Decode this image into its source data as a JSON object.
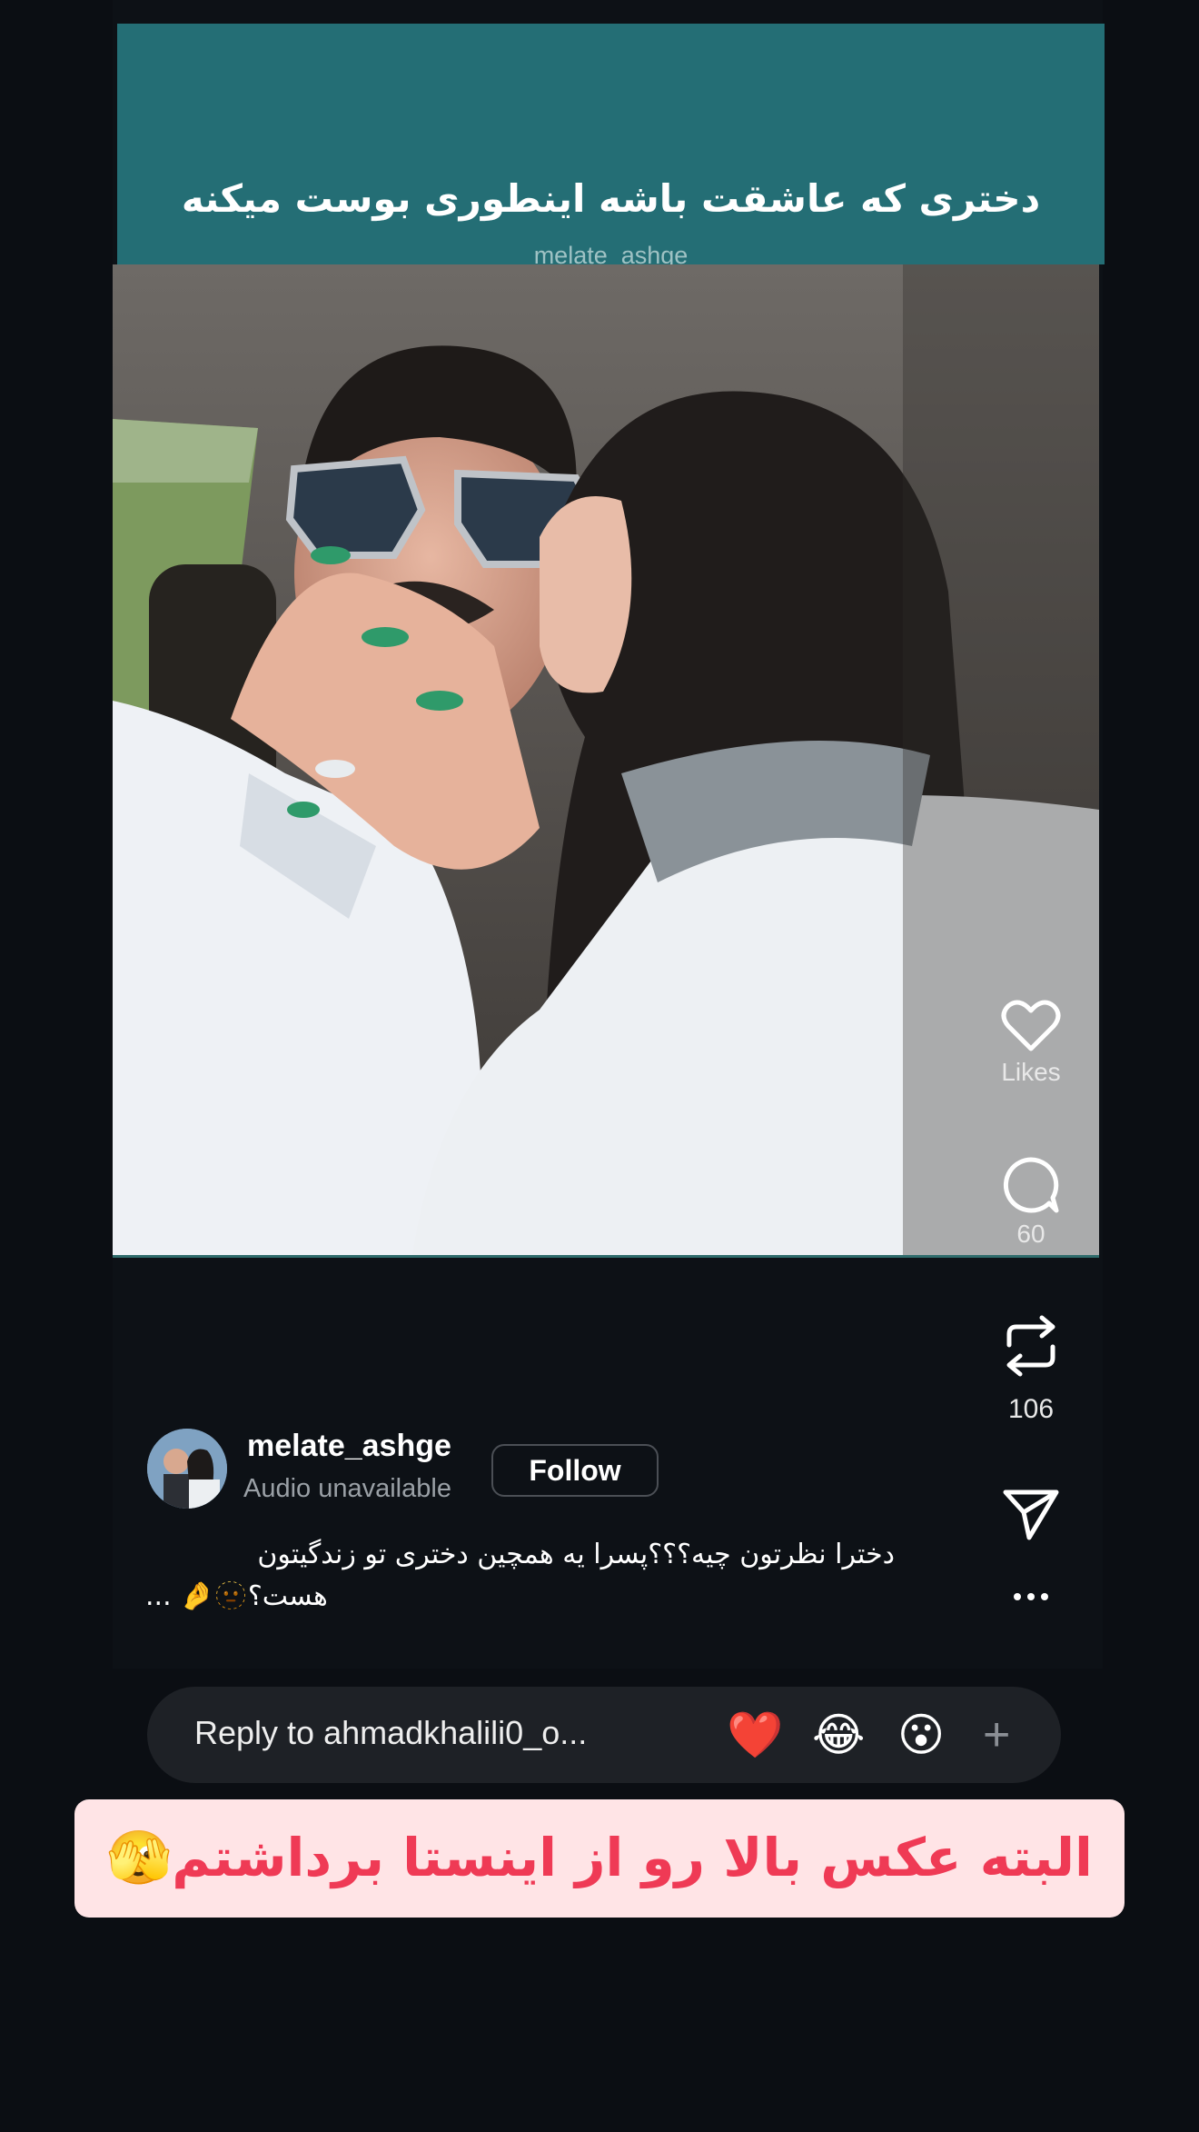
{
  "story": {
    "title": "دختری که عاشقت باشه اینطوری بوست میکنه",
    "handle": "melate_ashge"
  },
  "actions": {
    "likes_label": "Likes",
    "comments_count": "60",
    "reposts_count": "106",
    "like_icon": "heart-icon",
    "comment_icon": "comment-bubble-icon",
    "repost_icon": "repost-icon",
    "share_icon": "send-icon",
    "more_icon": "more-dots-icon"
  },
  "author": {
    "name": "melate_ashge",
    "audio": "Audio unavailable",
    "follow_label": "Follow"
  },
  "caption": {
    "line1": "دخترا نظرتون چیه؟؟؟پسرا یه همچین دختری تو زندگیتون",
    "line2": "... 🤌🫥هست؟"
  },
  "reply": {
    "placeholder": "Reply to ahmadkhalili0_o...",
    "reactions": [
      "❤️",
      "😂",
      "😮"
    ],
    "add_label": "+"
  },
  "banner": {
    "text": "البته عکس بالا رو از اینستا برداشتم🫣"
  },
  "colors": {
    "header_teal": "#246e75",
    "banner_bg": "#ffe4e6",
    "banner_text": "#ef3a55",
    "background": "#0b0e13"
  }
}
